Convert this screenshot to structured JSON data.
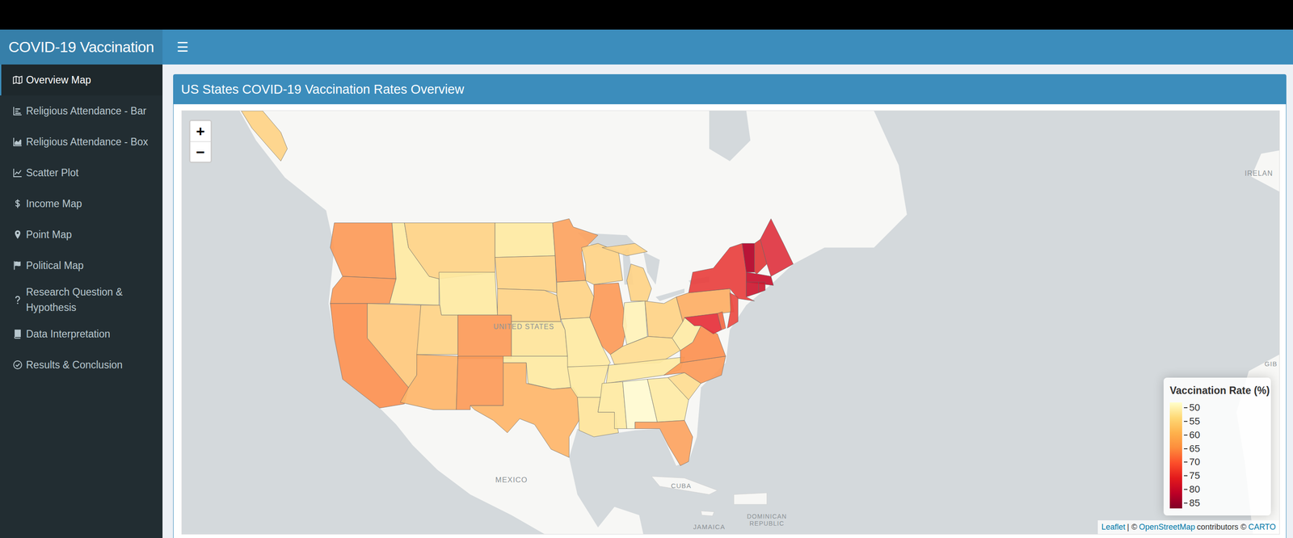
{
  "app": {
    "title": "COVID-19 Vaccination",
    "menu_toggle": "☰"
  },
  "sidebar": {
    "items": [
      {
        "label": "Overview Map",
        "selected": true
      },
      {
        "label": "Religious Attendance - Bar",
        "selected": false
      },
      {
        "label": "Religious Attendance - Box",
        "selected": false
      },
      {
        "label": "Scatter Plot",
        "selected": false
      },
      {
        "label": "Income Map",
        "selected": false
      },
      {
        "label": "Point Map",
        "selected": false
      },
      {
        "label": "Political Map",
        "selected": false
      },
      {
        "label": "Research Question & Hypothesis",
        "selected": false
      },
      {
        "label": "Data Interpretation",
        "selected": false
      },
      {
        "label": "Results & Conclusion",
        "selected": false
      }
    ]
  },
  "box": {
    "title": "US States COVID-19 Vaccination Rates Overview"
  },
  "map": {
    "zoom_in": "+",
    "zoom_out": "−",
    "labels": [
      "UNITED STATES",
      "MEXICO",
      "CUBA",
      "JAMAICA",
      "DOMINICAN",
      "REPUBLIC",
      "IRELAN",
      "GIB"
    ],
    "regions": [
      {
        "color": "#fc9a58"
      },
      {
        "color": "#fc9a58"
      },
      {
        "color": "#fee9a2"
      },
      {
        "color": "#fc9050"
      },
      {
        "color": "#fec87c"
      },
      {
        "color": "#fed386"
      },
      {
        "color": "#feb569"
      },
      {
        "color": "#fed386"
      },
      {
        "color": "#fee9a2"
      },
      {
        "color": "#fc9a58"
      },
      {
        "color": "#fc9a58"
      },
      {
        "color": "#fee9a2"
      },
      {
        "color": "#fed386"
      },
      {
        "color": "#fed386"
      },
      {
        "color": "#fee49a"
      },
      {
        "color": "#fee9a2"
      },
      {
        "color": "#feb569"
      },
      {
        "color": "#fca35f"
      },
      {
        "color": "#fed386"
      },
      {
        "color": "#fee9a2"
      },
      {
        "color": "#fee9a2"
      },
      {
        "color": "#fee49a"
      },
      {
        "color": "#fed386"
      },
      {
        "color": "#fc9a58"
      },
      {
        "color": "#fed386"
      },
      {
        "color": "#fff2b8"
      },
      {
        "color": "#fed386"
      },
      {
        "color": "#fedc90"
      },
      {
        "color": "#fee9a2"
      },
      {
        "color": "#fee9a2"
      },
      {
        "color": "#fffad0"
      },
      {
        "color": "#feeaa5"
      },
      {
        "color": "#fca35f"
      },
      {
        "color": "#fedc90"
      },
      {
        "color": "#fc9a58"
      },
      {
        "color": "#fc9050"
      },
      {
        "color": "#feeaa5"
      },
      {
        "color": "#fdae64"
      },
      {
        "color": "#e6303a"
      },
      {
        "color": "#f36a45"
      },
      {
        "color": "#ea4a42"
      },
      {
        "color": "#e8403e"
      },
      {
        "color": "#b30026"
      },
      {
        "color": "#e03838"
      },
      {
        "color": "#de3440"
      },
      {
        "color": "#c8102e"
      },
      {
        "color": "#cc1830"
      },
      {
        "color": "#cc1830"
      },
      {
        "color": "#fed386"
      }
    ],
    "legend": {
      "title": "Vaccination Rate (%)",
      "ticks": [
        "50",
        "55",
        "60",
        "65",
        "70",
        "75",
        "80",
        "85"
      ]
    },
    "attribution": [
      {
        "text": "Leaflet",
        "link": true
      },
      {
        "text": "| ©",
        "link": false
      },
      {
        "text": "OpenStreetMap",
        "link": true
      },
      {
        "text": "contributors ©",
        "link": false
      },
      {
        "text": "CARTO",
        "link": true
      }
    ]
  }
}
